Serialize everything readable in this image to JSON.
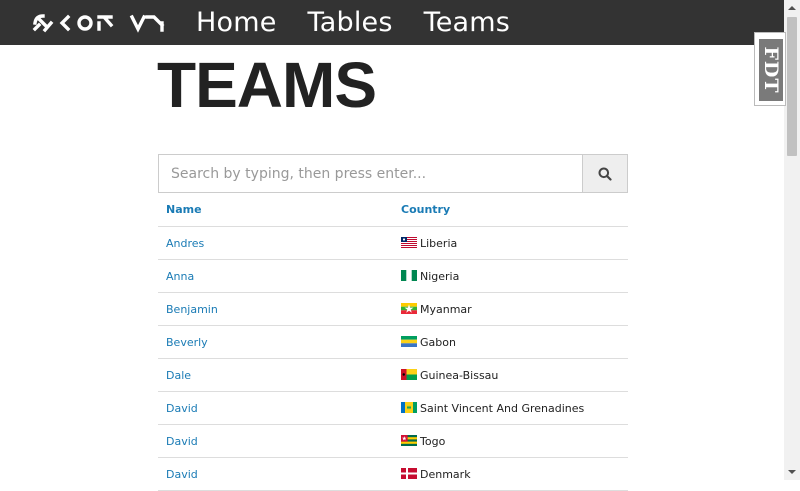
{
  "nav": {
    "links": [
      "Home",
      "Tables",
      "Teams"
    ]
  },
  "badge": {
    "text": "FDT"
  },
  "page": {
    "title": "TEAMS"
  },
  "search": {
    "placeholder": "Search by typing, then press enter...",
    "button_icon": "search-icon"
  },
  "table": {
    "headers": {
      "name": "Name",
      "country": "Country"
    },
    "rows": [
      {
        "name": "Andres",
        "country": "Liberia",
        "flag": "liberia-flag-icon"
      },
      {
        "name": "Anna",
        "country": "Nigeria",
        "flag": "nigeria-flag-icon"
      },
      {
        "name": "Benjamin",
        "country": "Myanmar",
        "flag": "myanmar-flag-icon"
      },
      {
        "name": "Beverly",
        "country": "Gabon",
        "flag": "gabon-flag-icon"
      },
      {
        "name": "Dale",
        "country": "Guinea-Bissau",
        "flag": "guinea-bissau-flag-icon"
      },
      {
        "name": "David",
        "country": "Saint Vincent And Grenadines",
        "flag": "saint-vincent-flag-icon"
      },
      {
        "name": "David",
        "country": "Togo",
        "flag": "togo-flag-icon"
      },
      {
        "name": "David",
        "country": "Denmark",
        "flag": "denmark-flag-icon"
      }
    ]
  },
  "colors": {
    "navbar": "#333333",
    "link": "#1a7bb5",
    "title": "#222222"
  }
}
